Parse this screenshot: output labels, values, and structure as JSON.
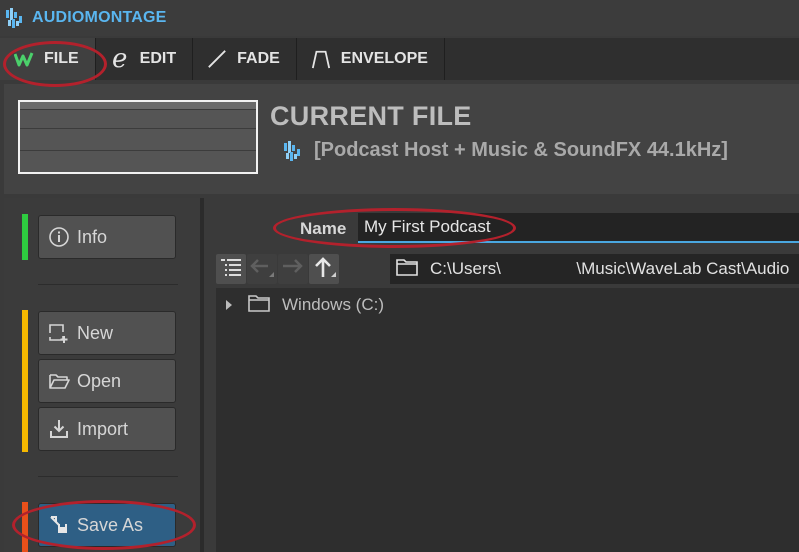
{
  "app": {
    "title": "AUDIOMONTAGE"
  },
  "tabs": [
    {
      "label": "FILE",
      "icon": "wavelab-logo-icon",
      "active": true
    },
    {
      "label": "EDIT",
      "icon": "e-letter-icon",
      "active": false
    },
    {
      "label": "FADE",
      "icon": "fade-line-icon",
      "active": false
    },
    {
      "label": "ENVELOPE",
      "icon": "envelope-shape-icon",
      "active": false
    }
  ],
  "header": {
    "section_title": "CURRENT FILE",
    "file_description": "[Podcast Host + Music & SoundFX 44.1kHz]"
  },
  "sidebar": {
    "info_label": "Info",
    "new_label": "New",
    "open_label": "Open",
    "import_label": "Import",
    "save_as_label": "Save As"
  },
  "main": {
    "name_label": "Name",
    "name_value": "My First Podcast",
    "path": "C:\\Users\\                \\Music\\WaveLab Cast\\Audio",
    "tree_root": "Windows (C:)"
  },
  "colors": {
    "accent_blue": "#5ab6f0",
    "accent_green": "#2ecc40",
    "accent_yellow": "#f5b800",
    "accent_orange": "#e8501a",
    "selected_button": "#2e5f85",
    "annotation_red": "#b3212c"
  }
}
